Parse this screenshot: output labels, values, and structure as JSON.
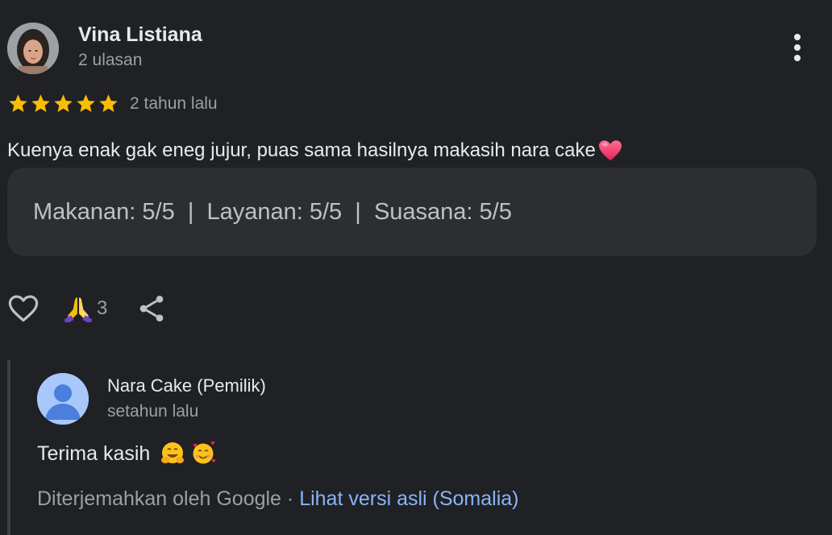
{
  "review": {
    "reviewer_name": "Vina Listiana",
    "reviewer_meta": "2 ulasan",
    "rating": 5,
    "max_rating": 5,
    "time_ago": "2 tahun lalu",
    "text": "Kuenya enak gak eneg jujur, puas sama hasilnya makasih nara cake",
    "text_emoji": "heart-icon",
    "ratings_summary": "Makanan: 5/5  |  Layanan: 5/5  |  Suasana: 5/5"
  },
  "actions": {
    "thanks_count": "3"
  },
  "reply": {
    "owner_name": "Nara Cake (Pemilik)",
    "time_ago": "setahun lalu",
    "text": "Terima kasih",
    "emojis": [
      "hugging-face-emoji",
      "smiling-face-with-hearts-emoji"
    ],
    "translated_by": "Diterjemahkan oleh Google",
    "separator": " · ",
    "original_link": "Lihat versi asli (Somalia)"
  },
  "colors": {
    "background": "#202124",
    "card": "#2d2e31",
    "star": "#fbbc04",
    "link": "#8ab4f8",
    "secondary_text": "#9aa0a6"
  }
}
